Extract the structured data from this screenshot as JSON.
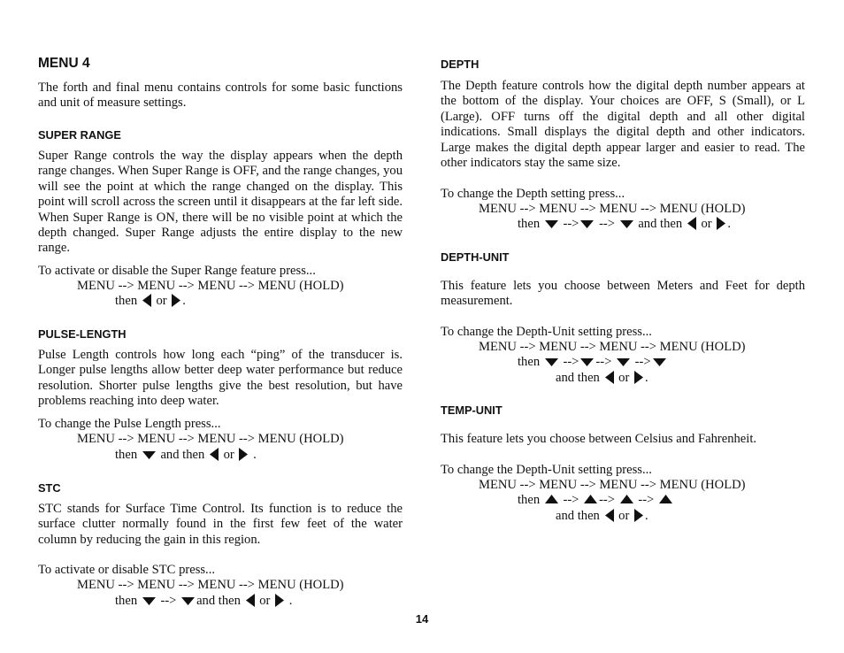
{
  "page_number": "14",
  "left": {
    "title": "MENU 4",
    "intro": "The forth and final menu contains controls for some basic functions and unit of measure settings.",
    "super_range": {
      "heading": "SUPER RANGE",
      "body": "Super Range controls the way the display appears when the depth range changes. When Super Range is OFF, and the range changes, you will see the point at which the range changed on the display. This point will scroll across the screen until it disappears at the far left side. When Super Range is ON, there will be no visible point at which the depth changed. Super Range adjusts the entire display to the new range.",
      "instr": "To activate or disable the Super Range feature press...",
      "sequence": "MENU --> MENU --> MENU --> MENU (HOLD)",
      "then": "then",
      "or": "or",
      "period": "."
    },
    "pulse_length": {
      "heading": "PULSE-LENGTH",
      "body": "Pulse Length controls how long each “ping” of the transducer is. Longer pulse lengths allow better deep water performance but reduce resolution. Shorter pulse lengths give the best resolution, but have problems reaching into deep water.",
      "instr": "To change the Pulse Length press...",
      "sequence": "MENU --> MENU --> MENU --> MENU (HOLD)",
      "then": "then",
      "and_then": "and then",
      "or": "or",
      "period": "."
    },
    "stc": {
      "heading": "STC",
      "body": "STC stands for Surface Time Control. Its function is to reduce the surface clutter normally found in the first few feet of the water column by reducing the gain in this region.",
      "instr": "To activate or disable STC press...",
      "sequence": "MENU --> MENU --> MENU --> MENU (HOLD)",
      "then": "then",
      "arrow_sep": "-->",
      "and_then": "and then",
      "or": "or",
      "period": "."
    }
  },
  "right": {
    "depth": {
      "heading": "DEPTH",
      "body": "The Depth feature controls how the digital depth number appears at the bottom of the display. Your choices are OFF, S (Small), or L (Large). OFF turns off the digital depth and all other digital indications. Small displays the digital depth and other indicators. Large makes the digital depth appear larger and easier to read. The other indicators stay the same size.",
      "instr": "To change the Depth setting press...",
      "sequence": "MENU --> MENU --> MENU --> MENU (HOLD)",
      "then": "then",
      "arrow_sep": "-->",
      "and_then": "and then",
      "or": "or",
      "period": "."
    },
    "depth_unit": {
      "heading": "DEPTH-UNIT",
      "body": "This feature lets you choose between Meters and Feet for depth measurement.",
      "instr": "To change the Depth-Unit setting press...",
      "sequence": "MENU --> MENU --> MENU --> MENU (HOLD)",
      "then": "then",
      "arrow_sep": "-->",
      "and_then": "and then",
      "or": "or",
      "period": "."
    },
    "temp_unit": {
      "heading": "TEMP-UNIT",
      "body": "This feature lets you choose between Celsius and Fahrenheit.",
      "instr": "To change the Depth-Unit setting press...",
      "sequence": "MENU --> MENU --> MENU --> MENU (HOLD)",
      "then": "then",
      "arrow_sep": "-->",
      "and_then": "and then",
      "or": "or",
      "period": "."
    }
  },
  "icons": {
    "down": "down-arrow-key",
    "up": "up-arrow-key",
    "left": "left-arrow-key",
    "right": "right-arrow-key"
  }
}
